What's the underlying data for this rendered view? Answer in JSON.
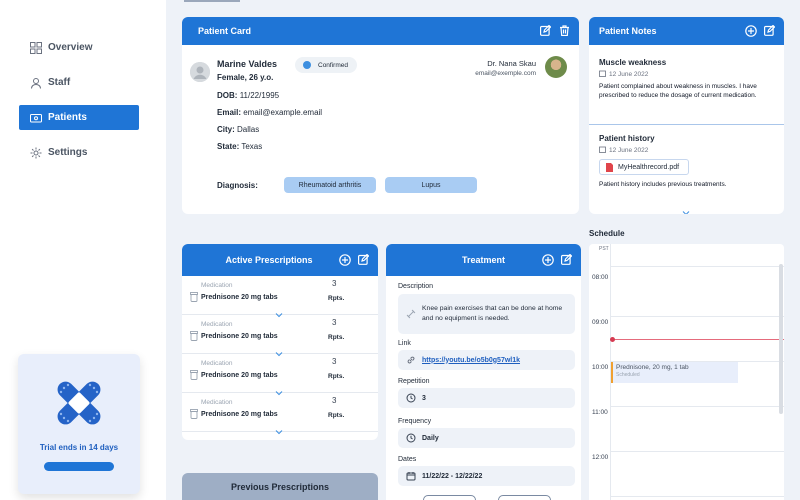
{
  "sidebar": {
    "items": [
      {
        "label": "Overview",
        "icon": "grid-icon"
      },
      {
        "label": "Staff",
        "icon": "user-icon"
      },
      {
        "label": "Patients",
        "icon": "wallet-icon"
      },
      {
        "label": "Settings",
        "icon": "gear-icon"
      }
    ],
    "active_index": 2,
    "trial": {
      "text": "Trial ends in 14 days"
    }
  },
  "patient_card": {
    "title": "Patient Card",
    "name": "Marine Valdes",
    "subtitle": "Female, 26 y.o.",
    "status": "Confirmed",
    "fields": [
      {
        "label": "DOB:",
        "value": "11/22/1995"
      },
      {
        "label": "Email:",
        "value": "email@example.email"
      },
      {
        "label": "City:",
        "value": "Dallas"
      },
      {
        "label": "State:",
        "value": "Texas"
      }
    ],
    "doctor_name": "Dr. Nana Skau",
    "doctor_email": "email@exemple.com",
    "diagnosis_label": "Diagnosis:",
    "diagnoses": [
      "Rheumatoid arthritis",
      "Lupus"
    ]
  },
  "patient_notes": {
    "title": "Patient Notes",
    "notes": [
      {
        "title": "Muscle weakness",
        "date": "12 June 2022",
        "body": "Patient complained about weakness in muscles. I have prescribed to reduce the dosage of current medication."
      },
      {
        "title": "Patient history",
        "date": "12 June 2022",
        "file": "MyHealthrecord.pdf",
        "body": "Patient history includes previous treatments."
      }
    ]
  },
  "active_prescriptions": {
    "title": "Active Prescriptions",
    "rows": [
      {
        "label": "Medication",
        "value": "Prednisone 20 mg tabs",
        "count": "3",
        "unit": "Rpts."
      },
      {
        "label": "Medication",
        "value": "Prednisone 20 mg tabs",
        "count": "3",
        "unit": "Rpts."
      },
      {
        "label": "Medication",
        "value": "Prednisone 20 mg tabs",
        "count": "3",
        "unit": "Rpts."
      },
      {
        "label": "Medication",
        "value": "Prednisone 20 mg tabs",
        "count": "3",
        "unit": "Rpts."
      }
    ]
  },
  "previous_prescriptions": {
    "title": "Previous Prescriptions"
  },
  "treatment": {
    "title": "Treatment",
    "description_label": "Description",
    "description": "Knee pain exercises that can be done at home and no equipment is needed.",
    "link_label": "Link",
    "link": "https://youtu.be/o5b0g57wl1k",
    "repetition_label": "Repetition",
    "repetition": "3",
    "frequency_label": "Frequency",
    "frequency": "Daily",
    "dates_label": "Dates",
    "dates": "11/22/22 - 12/22/22"
  },
  "schedule": {
    "title": "Schedule",
    "timezone": "PST",
    "times": [
      "08:00",
      "09:00",
      "10:00",
      "11:00",
      "12:00"
    ],
    "event": {
      "title": "Prednisone, 20 mg, 1 tab",
      "status": "Scheduled"
    }
  },
  "colors": {
    "primary": "#1f75d6",
    "background": "#eef2f8",
    "pill": "#a9ccf3",
    "now": "#d53b52",
    "event_accent": "#f0a030"
  }
}
